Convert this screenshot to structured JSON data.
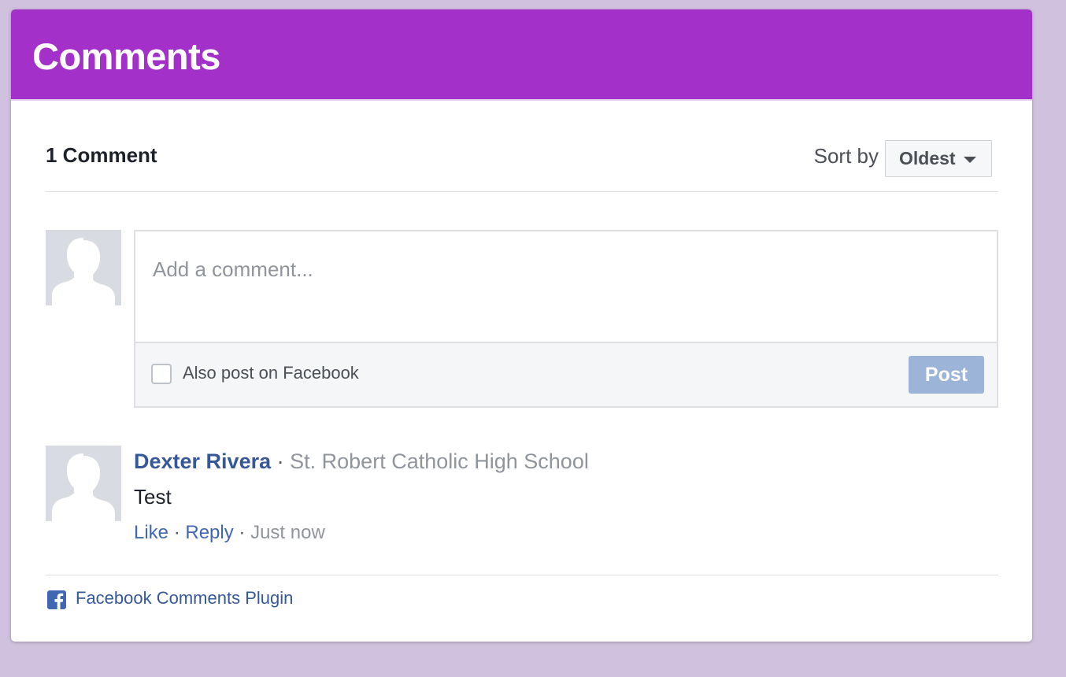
{
  "header": {
    "title": "Comments"
  },
  "plugin": {
    "count_label": "1 Comment",
    "sort_label": "Sort by",
    "sort_value": "Oldest",
    "composer": {
      "placeholder": "Add a comment...",
      "also_post_label": "Also post on Facebook",
      "post_label": "Post"
    },
    "comments": [
      {
        "author": "Dexter Rivera",
        "separator": "·",
        "affiliation": "St. Robert Catholic High School",
        "text": "Test",
        "like_label": "Like",
        "reply_label": "Reply",
        "time": "Just now"
      }
    ],
    "footer": {
      "plugin_label": "Facebook Comments Plugin",
      "icon": "facebook-icon"
    }
  },
  "colors": {
    "header": "#a331c9",
    "background": "#d0c1de",
    "link": "#365899",
    "post_button": "#9cb4d8"
  }
}
